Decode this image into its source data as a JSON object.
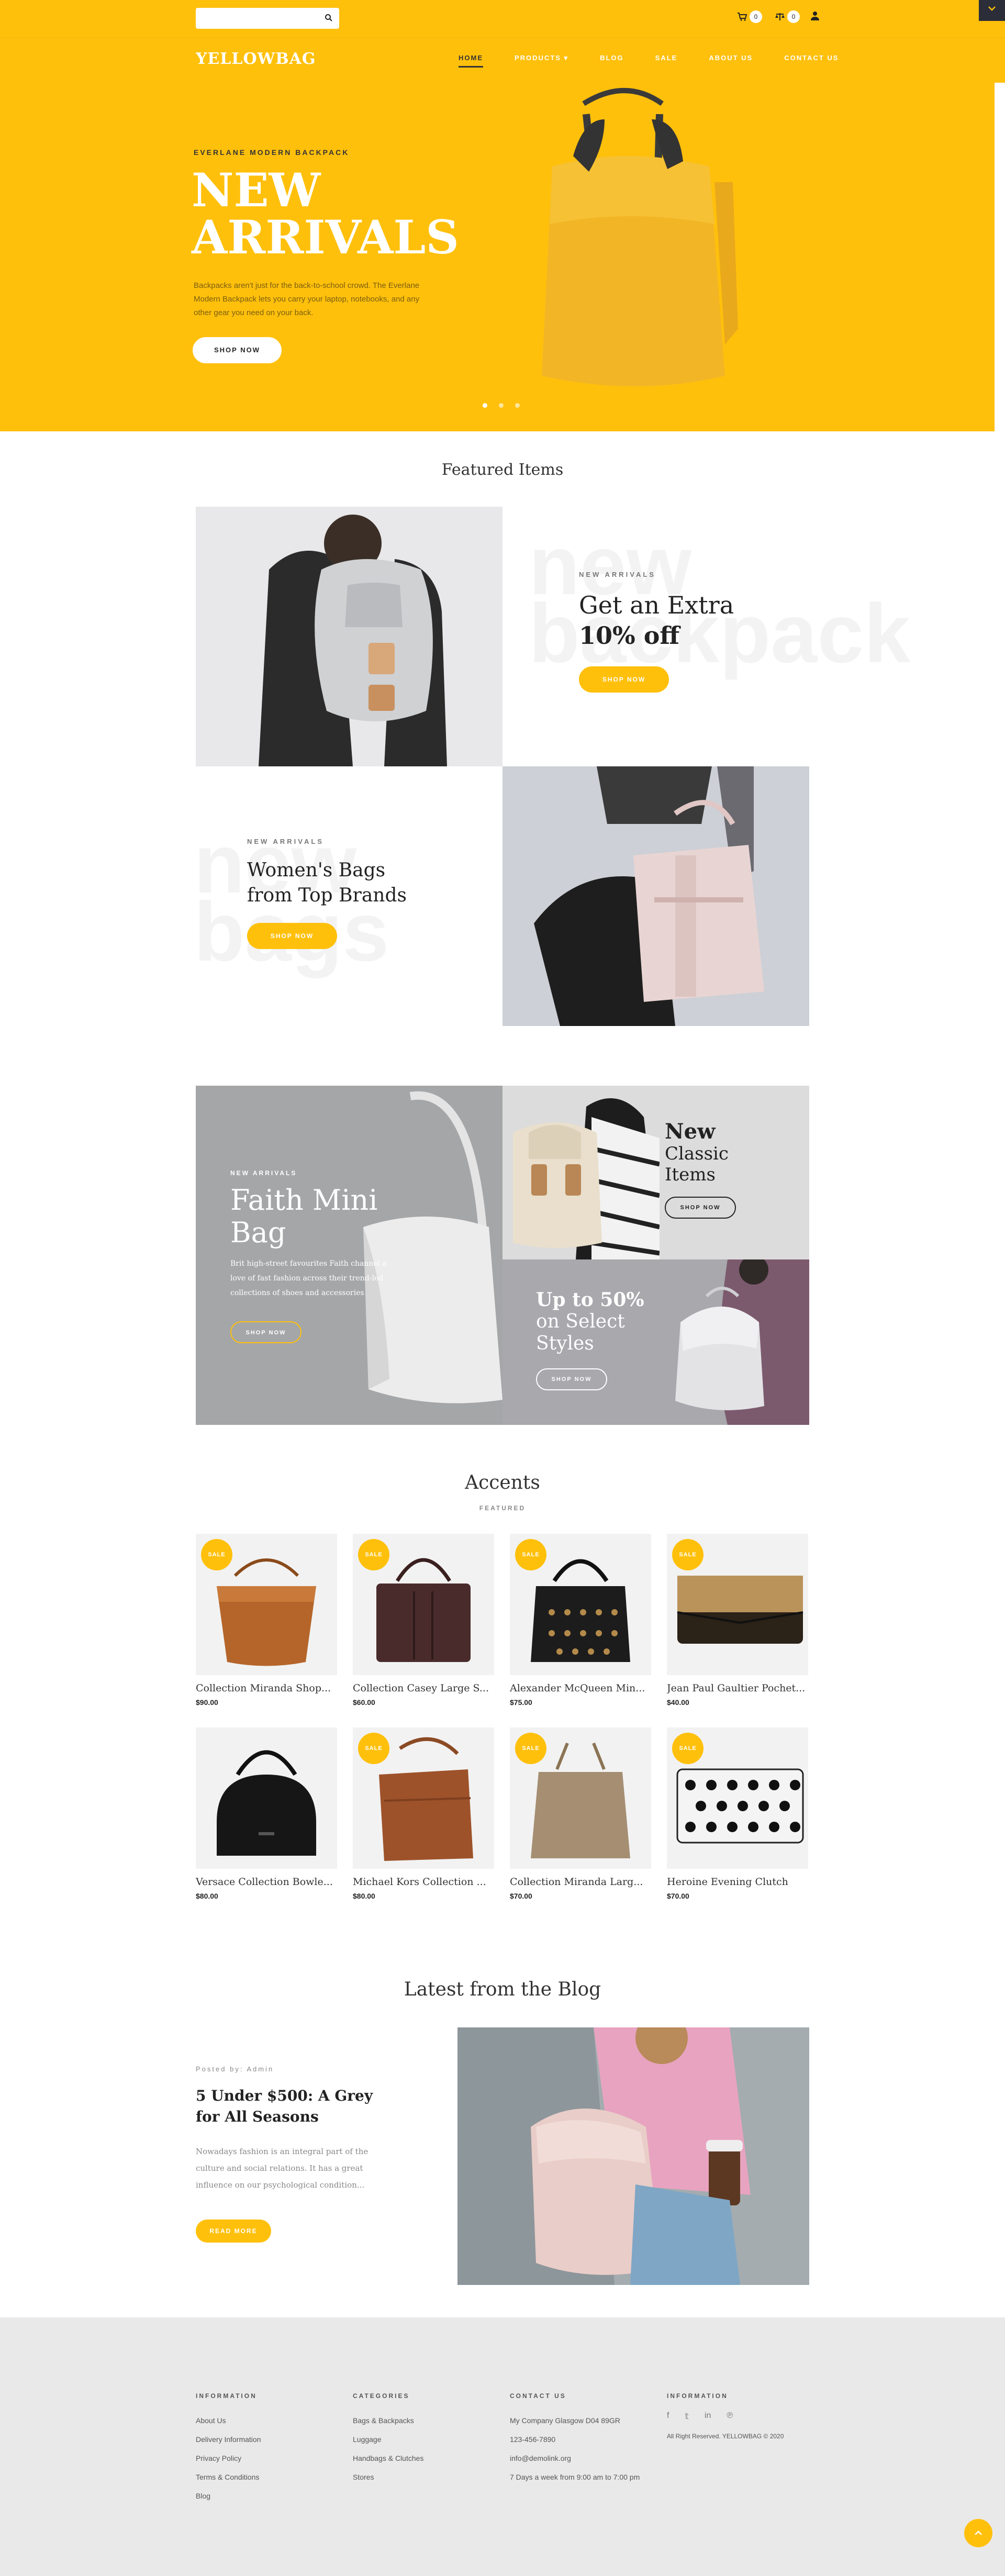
{
  "header": {
    "search_placeholder": "",
    "cart_count": "0",
    "compare_count": "0",
    "logo": "YELLOWBAG",
    "nav": [
      {
        "label": "HOME",
        "active": true
      },
      {
        "label": "PRODUCTS ▾",
        "active": false
      },
      {
        "label": "BLOG",
        "active": false
      },
      {
        "label": "SALE",
        "active": false
      },
      {
        "label": "ABOUT US",
        "active": false
      },
      {
        "label": "CONTACT US",
        "active": false
      }
    ]
  },
  "hero": {
    "eyebrow": "EVERLANE MODERN BACKPACK",
    "title_line1": "NEW",
    "title_line2": "ARRIVALS",
    "description": "Backpacks aren't just for the back-to-school crowd. The Everlane Modern Backpack lets you carry your laptop, notebooks, and any other gear you need on your back.",
    "button": "SHOP NOW",
    "slides": 3,
    "active_slide": 1
  },
  "featured": {
    "title": "Featured Items",
    "block1": {
      "bg_word_1": "new",
      "bg_word_2": "backpack",
      "eyebrow": "NEW ARRIVALS",
      "title_line1": "Get an Extra",
      "title_line2": "10% off",
      "button": "SHOP NOW"
    },
    "block2": {
      "bg_word_1": "new",
      "bg_word_2": "bags",
      "eyebrow": "NEW ARRIVALS",
      "title_line1": "Women's Bags",
      "title_line2": "from Top Brands",
      "button": "SHOP NOW"
    }
  },
  "promos": {
    "faith": {
      "eyebrow": "NEW ARRIVALS",
      "title_line1": "Faith Mini",
      "title_line2": "Bag",
      "description": "Brit high-street favourites Faith channel a love of fast fashion across their trend-led collections of shoes and accessories",
      "button": "SHOP NOW"
    },
    "classic": {
      "title_line1": "New",
      "title_line2": "Classic",
      "title_line3": "Items",
      "button": "SHOP NOW"
    },
    "select": {
      "title_line1": "Up to 50%",
      "title_line2": "on Select",
      "title_line3": "Styles",
      "button": "SHOP NOW"
    }
  },
  "accents": {
    "title": "Accents",
    "subtitle": "FEATURED",
    "sale_label": "SALE",
    "products": [
      {
        "name": "Collection Miranda Shop...",
        "price": "$90.00",
        "sale": true
      },
      {
        "name": "Collection Casey Large S...",
        "price": "$60.00",
        "sale": true
      },
      {
        "name": "Alexander McQueen Min...",
        "price": "$75.00",
        "sale": true
      },
      {
        "name": "Jean Paul Gaultier Pochet...",
        "price": "$40.00",
        "sale": true
      },
      {
        "name": "Versace Collection Bowle...",
        "price": "$80.00",
        "sale": false
      },
      {
        "name": "Michael Kors Collection ...",
        "price": "$80.00",
        "sale": true
      },
      {
        "name": "Collection Miranda Larg...",
        "price": "$70.00",
        "sale": true
      },
      {
        "name": "Heroine Evening Clutch",
        "price": "$70.00",
        "sale": true
      }
    ]
  },
  "blog": {
    "title": "Latest from the Blog",
    "posted_by": "Posted by: Admin",
    "post_title_line1": "5 Under $500: A Grey",
    "post_title_line2": "for All Seasons",
    "excerpt": "Nowadays fashion is an integral part of the culture and social relations. It has a great influence on our psychological condition...",
    "button": "READ MORE"
  },
  "footer": {
    "col1": {
      "heading": "INFORMATION",
      "items": [
        "About Us",
        "Delivery Information",
        "Privacy Policy",
        "Terms & Conditions",
        "Blog"
      ]
    },
    "col2": {
      "heading": "CATEGORIES",
      "items": [
        "Bags & Backpacks",
        "Luggage",
        "Handbags & Clutches",
        "Stores"
      ]
    },
    "col3": {
      "heading": "CONTACT US",
      "items": [
        "My Company Glasgow D04 89GR",
        "123-456-7890",
        "info@demolink.org",
        "7 Days a week from 9:00 am to 7:00 pm"
      ]
    },
    "col4": {
      "heading": "INFORMATION",
      "copyright": "All Right Reserved. YELLOWBAG © 2020"
    }
  },
  "colors": {
    "brand_yellow": "#ffc00c",
    "dark": "#2b2e38"
  }
}
